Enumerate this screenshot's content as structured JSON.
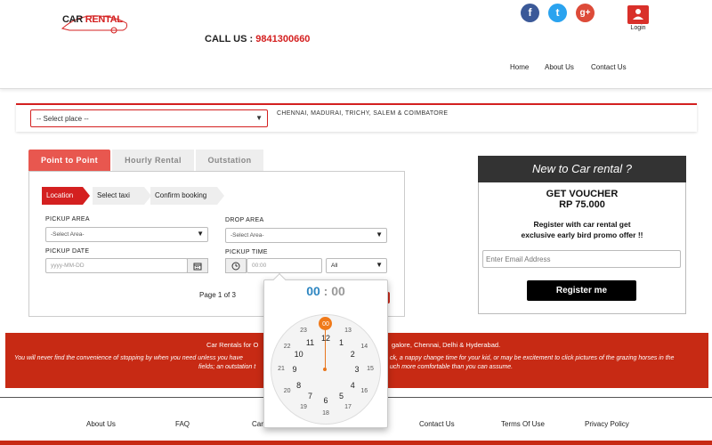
{
  "header": {
    "logo": {
      "car": "CAR",
      "rental": "RENTAL"
    },
    "call_label": "CALL US :",
    "call_number": "9841300660",
    "social": {
      "facebook": "f",
      "twitter": "t",
      "google": "g+"
    },
    "login_label": "Login",
    "nav": [
      "Home",
      "About Us",
      "Contact Us"
    ]
  },
  "search": {
    "place_value": "-- Select place --",
    "cities": "CHENNAI, MADURAI, TRICHY, SALEM & COIMBATORE"
  },
  "tabs": [
    "Point to Point",
    "Hourly Rental",
    "Outstation"
  ],
  "steps": [
    "Location",
    "Select taxi",
    "Confirm booking"
  ],
  "form": {
    "pickup_area_label": "PICKUP AREA",
    "pickup_area_value": "-Select Area-",
    "drop_area_label": "DROP AREA",
    "drop_area_value": "-Select Area-",
    "pickup_date_label": "PICKUP DATE",
    "pickup_date_placeholder": "yyyy-MM-DD",
    "pickup_time_label": "PICKUP TIME",
    "pickup_time_placeholder": "00:00",
    "ampm_value": "All",
    "page_info": "Page 1 of 3"
  },
  "voucher": {
    "title": "New to Car rental ?",
    "get_voucher": "GET VOUCHER",
    "amount": "RP 75.000",
    "line1": "Register with car rental get",
    "line2": "exclusive early bird promo offer !!",
    "email_placeholder": "Enter Email Address",
    "register_label": "Register me"
  },
  "info_band": {
    "title_start": "Car Rentals for O",
    "title_end": "galore, Chennai, Delhi & Hyderabad.",
    "body_line1_start": "You will never find the convenience of stopping by when you need unless you have",
    "body_line1_end": "ck, a nappy change time for your kid, or may be excitement to click pictures of the grazing horses in the",
    "body_line2_start": "fields; an outstation t",
    "body_line2_end": "uch more comfortable than you can assume."
  },
  "footer": {
    "links": [
      "About Us",
      "FAQ",
      "Car",
      "Contact Us",
      "Terms Of Use",
      "Privacy Policy"
    ]
  },
  "clock": {
    "hours": "00",
    "separator": ":",
    "minutes": "00",
    "inner": [
      "12",
      "1",
      "2",
      "3",
      "4",
      "5",
      "6",
      "7",
      "8",
      "9",
      "10",
      "11"
    ],
    "outer": [
      "00",
      "13",
      "14",
      "15",
      "16",
      "17",
      "18",
      "19",
      "20",
      "21",
      "22",
      "23"
    ]
  },
  "colors": {
    "accent": "#d42020",
    "band": "#c72a14",
    "clock_hand": "#f07a1a",
    "clock_hours": "#2e86c1"
  }
}
